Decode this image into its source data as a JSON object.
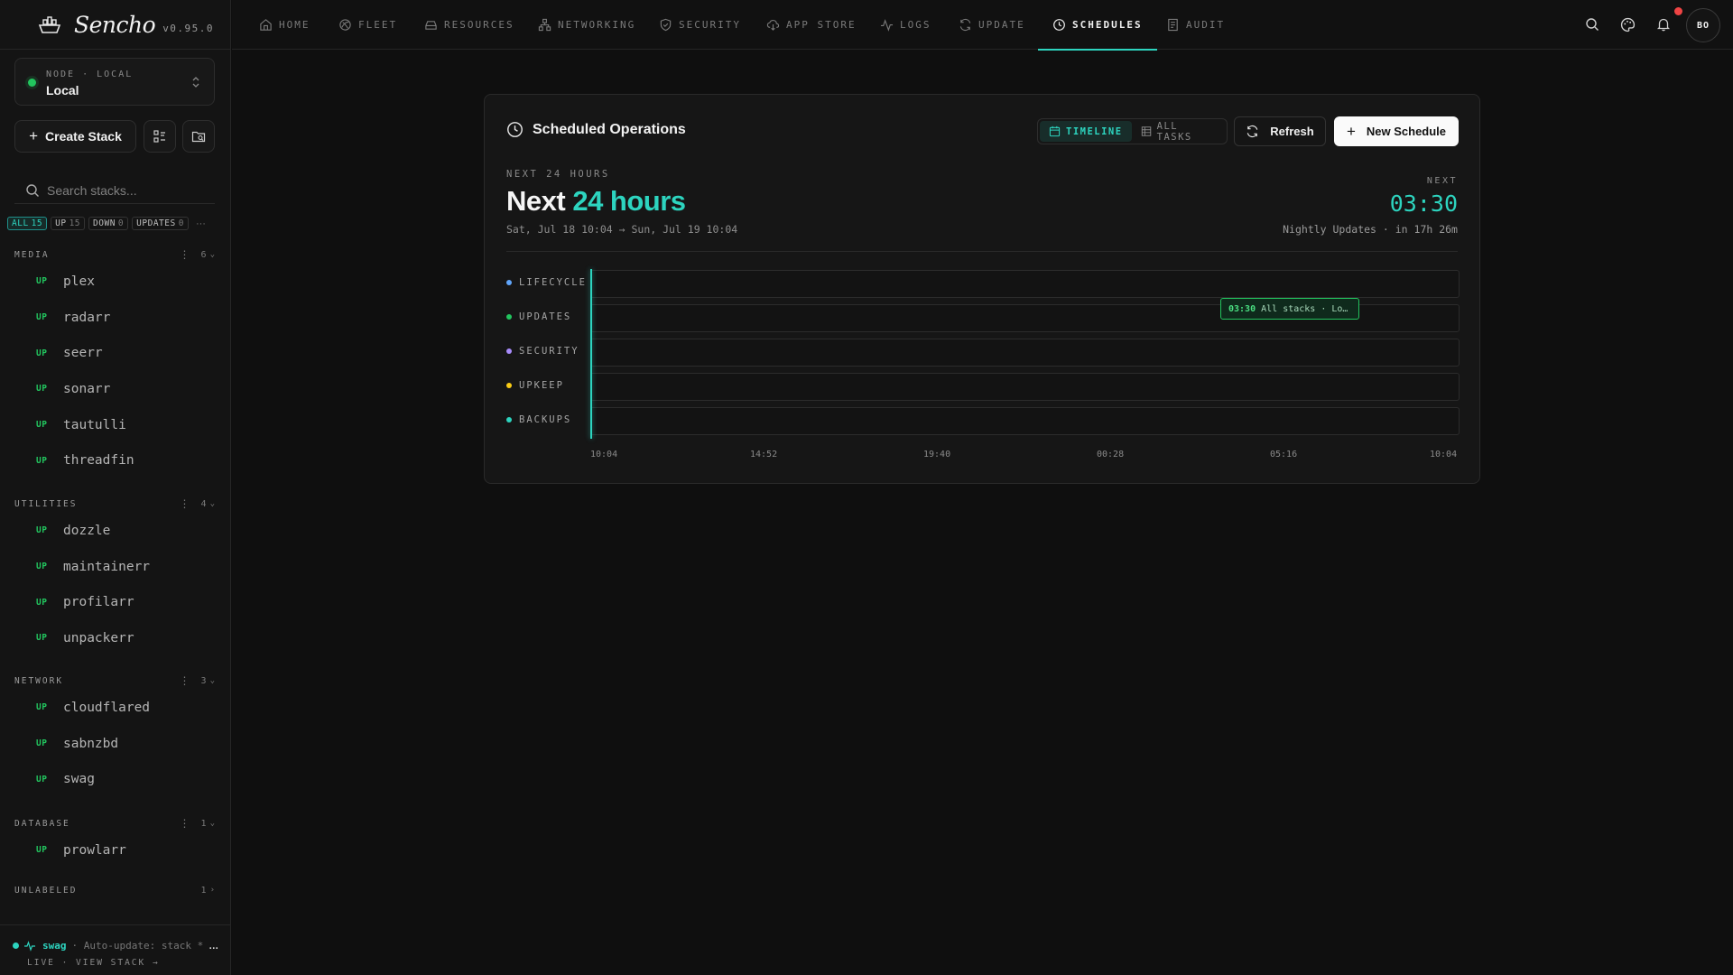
{
  "brand": {
    "name": "Sencho",
    "version": "v0.95.0"
  },
  "node": {
    "label": "NODE · LOCAL",
    "value": "Local"
  },
  "sidebar": {
    "create_label": "Create Stack",
    "search_placeholder": "Search stacks...",
    "filters": [
      {
        "label": "ALL",
        "count": "15",
        "active": true
      },
      {
        "label": "UP",
        "count": "15"
      },
      {
        "label": "DOWN",
        "count": "0"
      },
      {
        "label": "UPDATES",
        "count": "0"
      }
    ],
    "more": "···",
    "groups": [
      {
        "name": "MEDIA",
        "count": "6",
        "items": [
          {
            "status": "UP",
            "name": "plex"
          },
          {
            "status": "UP",
            "name": "radarr"
          },
          {
            "status": "UP",
            "name": "seerr"
          },
          {
            "status": "UP",
            "name": "sonarr"
          },
          {
            "status": "UP",
            "name": "tautulli"
          },
          {
            "status": "UP",
            "name": "threadfin"
          }
        ]
      },
      {
        "name": "UTILITIES",
        "count": "4",
        "items": [
          {
            "status": "UP",
            "name": "dozzle"
          },
          {
            "status": "UP",
            "name": "maintainerr"
          },
          {
            "status": "UP",
            "name": "profilarr"
          },
          {
            "status": "UP",
            "name": "unpackerr"
          }
        ]
      },
      {
        "name": "NETWORK",
        "count": "3",
        "items": [
          {
            "status": "UP",
            "name": "cloudflared"
          },
          {
            "status": "UP",
            "name": "sabnzbd"
          },
          {
            "status": "UP",
            "name": "swag"
          }
        ]
      },
      {
        "name": "DATABASE",
        "count": "1",
        "items": [
          {
            "status": "UP",
            "name": "prowlarr"
          }
        ]
      },
      {
        "name": "UNLABELED",
        "count": "1",
        "items": []
      }
    ],
    "live": {
      "stack": "swag",
      "message": "· Auto-update: stack *",
      "ellipsis": "…",
      "footer": "LIVE · VIEW STACK →"
    }
  },
  "nav": [
    {
      "label": "HOME",
      "icon": "home-icon"
    },
    {
      "label": "FLEET",
      "icon": "fleet-icon"
    },
    {
      "label": "RESOURCES",
      "icon": "resources-icon"
    },
    {
      "label": "NETWORKING",
      "icon": "networking-icon"
    },
    {
      "label": "SECURITY",
      "icon": "shield-icon"
    },
    {
      "label": "APP STORE",
      "icon": "cloud-download-icon"
    },
    {
      "label": "LOGS",
      "icon": "activity-icon"
    },
    {
      "label": "UPDATE",
      "icon": "refresh-icon"
    },
    {
      "label": "SCHEDULES",
      "icon": "clock-icon",
      "active": true
    },
    {
      "label": "AUDIT",
      "icon": "audit-icon"
    }
  ],
  "user": {
    "initials": "BO"
  },
  "schedules": {
    "title": "Scheduled Operations",
    "view_timeline": "TIMELINE",
    "view_all": "ALL TASKS",
    "refresh_label": "Refresh",
    "new_label": "New Schedule",
    "overline": "NEXT 24 HOURS",
    "headline_a": "Next",
    "headline_b": "24 hours",
    "range": "Sat, Jul 18 10:04 → Sun, Jul 19 10:04",
    "next_label": "NEXT",
    "next_time": "03:30",
    "next_desc": "Nightly Updates · in 17h 26m",
    "lanes": [
      {
        "label": "LIFECYCLE",
        "color": "#60a5fa"
      },
      {
        "label": "UPDATES",
        "color": "#22c55e"
      },
      {
        "label": "SECURITY",
        "color": "#a78bfa"
      },
      {
        "label": "UPKEEP",
        "color": "#facc15"
      },
      {
        "label": "BACKUPS",
        "color": "#2dd4bf"
      }
    ],
    "event": {
      "lane": "UPDATES",
      "time": "03:30",
      "desc": "All stacks · Lo…"
    },
    "ticks": [
      "10:04",
      "14:52",
      "19:40",
      "00:28",
      "05:16",
      "10:04"
    ]
  },
  "colors": {
    "accent": "#2dd4bf",
    "up": "#22c55e",
    "alert": "#ef4444"
  }
}
